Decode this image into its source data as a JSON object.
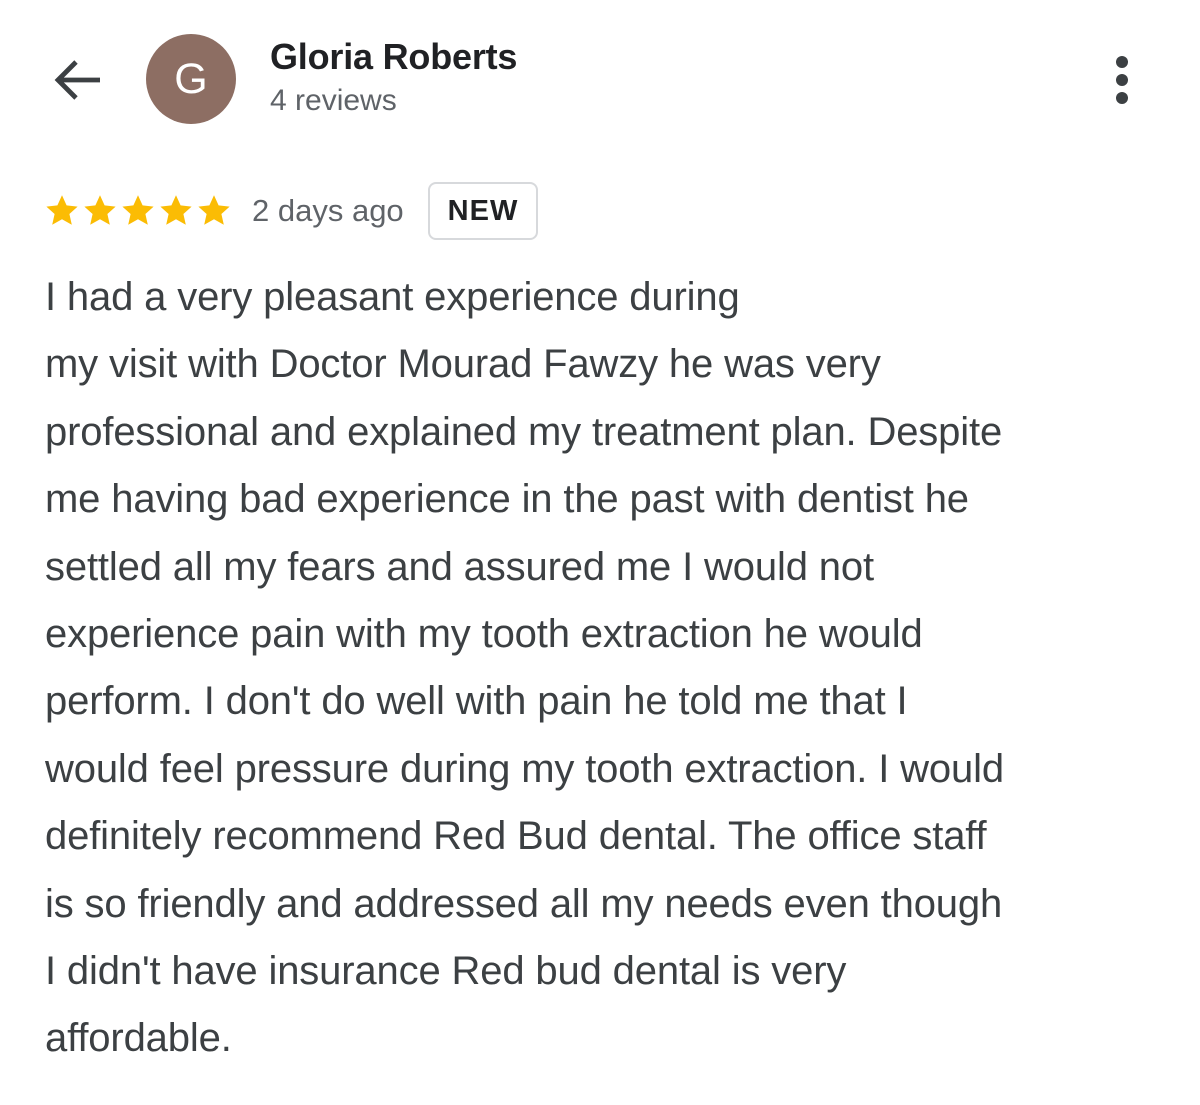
{
  "header": {
    "back_icon": "arrow-back-icon",
    "avatar_letter": "G",
    "avatar_color": "#8d6e63",
    "reviewer_name": "Gloria Roberts",
    "reviews_count": "4 reviews",
    "more_icon": "more-vertical-icon"
  },
  "review": {
    "rating": 5,
    "max_rating": 5,
    "star_color": "#fbbc04",
    "date": "2 days ago",
    "badge": "NEW",
    "lines": [
      "I had a very pleasant experience during",
      "my visit with Doctor Mourad Fawzy he was very",
      "professional and explained my treatment plan. Despite",
      "me having bad experience in the past with dentist he",
      "settled all my fears and assured me I would not",
      "experience pain with my tooth extraction he would",
      "perform. I don't do well with pain he told me that I",
      "would feel pressure during my tooth extraction. I would",
      "definitely recommend Red Bud dental. The office staff",
      "is so friendly and addressed all my needs even though",
      "I didn't have insurance Red bud dental is very",
      "affordable."
    ]
  }
}
